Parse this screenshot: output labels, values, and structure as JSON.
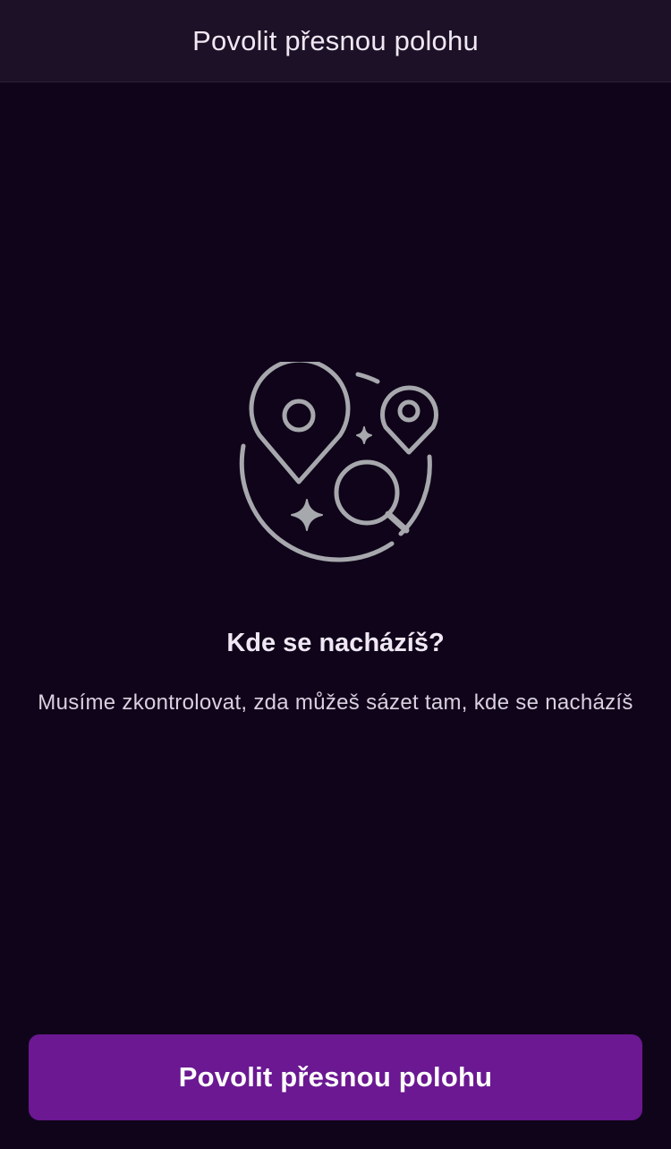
{
  "header": {
    "title": "Povolit přesnou polohu"
  },
  "illustration": {
    "icon": "location-search-icon",
    "stroke_color": "#a7a8ad"
  },
  "main": {
    "heading": "Kde se nacházíš?",
    "description": "Musíme zkontrolovat, zda můžeš sázet tam, kde se nacházíš"
  },
  "cta": {
    "label": "Povolit přesnou polohu",
    "background_color": "#6b1892"
  },
  "colors": {
    "background": "#10041a",
    "header_background": "#1c1126",
    "text": "#efe8f4"
  }
}
